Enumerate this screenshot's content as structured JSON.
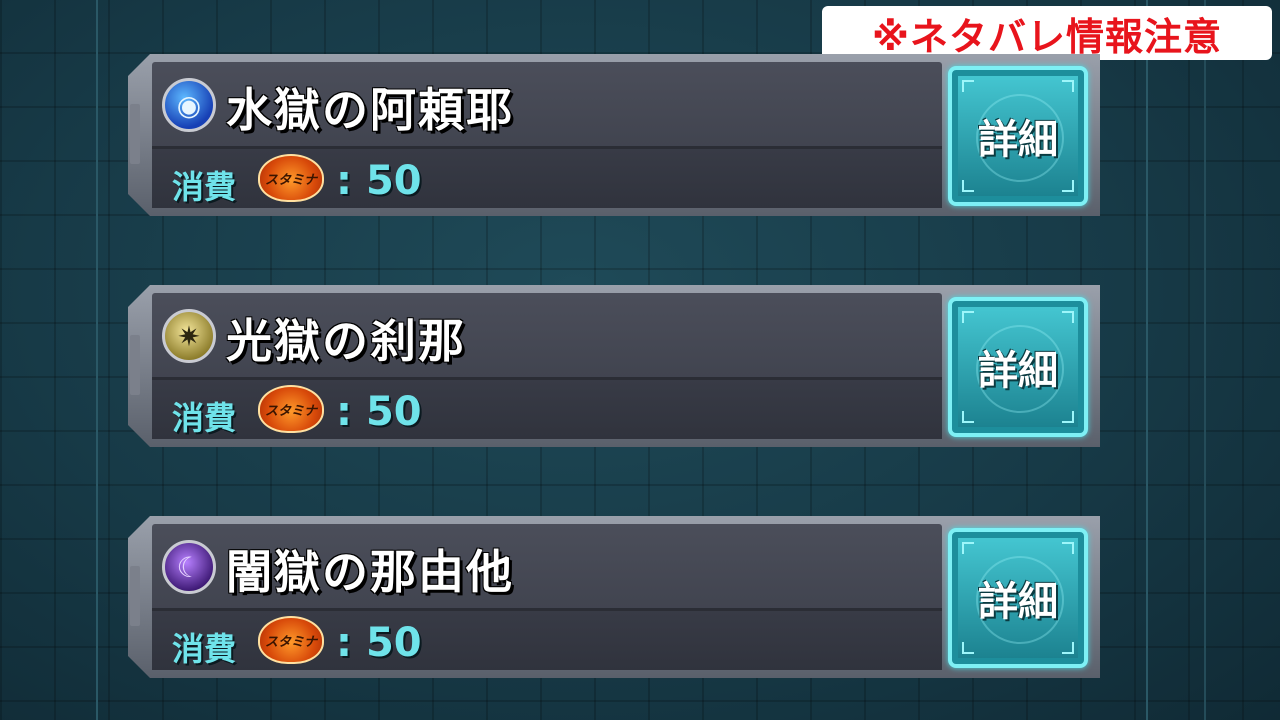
{
  "spoiler_notice": "※ネタバレ情報注意",
  "quests": [
    {
      "title": "水獄の阿頼耶",
      "element": "water",
      "icon": "water-element-icon",
      "cost_label": "消費",
      "stamina_label": "スタミナ",
      "cost_separator": ":",
      "cost_value": "50",
      "detail_label": "詳細"
    },
    {
      "title": "光獄の刹那",
      "element": "light",
      "icon": "light-element-icon",
      "cost_label": "消費",
      "stamina_label": "スタミナ",
      "cost_separator": ":",
      "cost_value": "50",
      "detail_label": "詳細"
    },
    {
      "title": "闇獄の那由他",
      "element": "dark",
      "icon": "dark-element-icon",
      "cost_label": "消費",
      "stamina_label": "スタミナ",
      "cost_separator": ":",
      "cost_value": "50",
      "detail_label": "詳細"
    }
  ],
  "colors": {
    "cost_text": "#6fe3ea",
    "detail_button": "#2aa9b6",
    "spoiler_text": "#e8141c"
  }
}
